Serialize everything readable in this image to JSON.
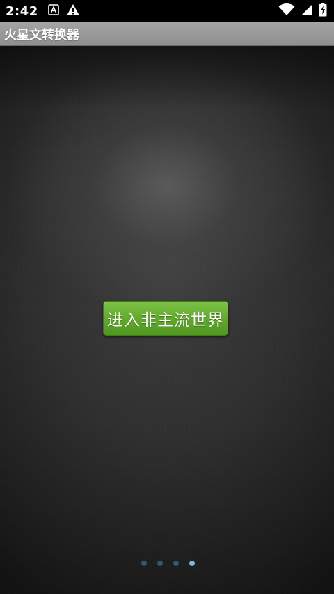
{
  "status_bar": {
    "time": "2:42",
    "left_icons": [
      "notification-a-icon",
      "warning-icon"
    ],
    "right_icons": [
      "wifi-icon",
      "battery-charging-icon"
    ]
  },
  "title_bar": {
    "title": "火星文转换器"
  },
  "main": {
    "enter_button_label": "进入非主流世界",
    "page_indicator": {
      "count": 4,
      "active_index": 3
    }
  },
  "colors": {
    "button_green": "#62ab2c",
    "title_bar_gray": "#9a9a9a",
    "dot_inactive": "#2f5a76",
    "dot_active": "#7fb6de"
  }
}
